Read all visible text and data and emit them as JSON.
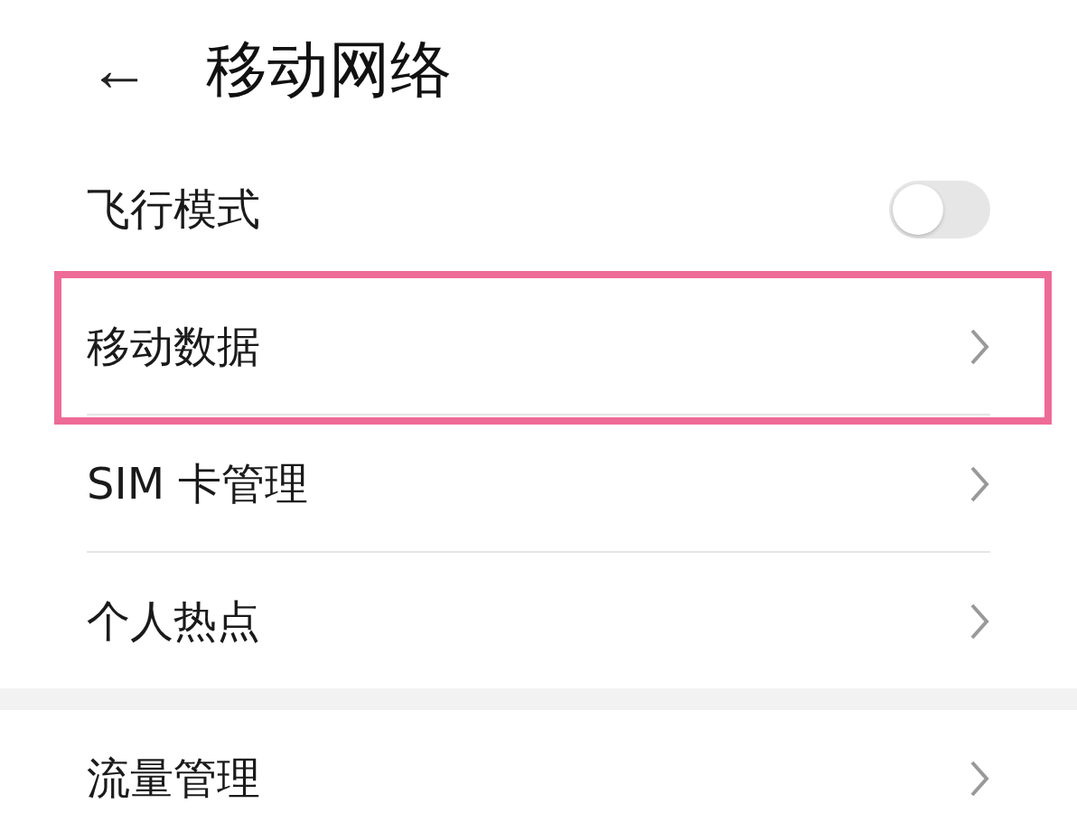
{
  "header": {
    "back": "←",
    "title": "移动网络"
  },
  "sections": [
    {
      "items": [
        {
          "kind": "toggle",
          "label": "飞行模式",
          "on": false,
          "highlighted": false
        },
        {
          "kind": "link",
          "label": "移动数据",
          "highlighted": true
        },
        {
          "kind": "link",
          "label": "SIM 卡管理",
          "highlighted": false
        },
        {
          "kind": "link",
          "label": "个人热点",
          "highlighted": false
        }
      ]
    },
    {
      "items": [
        {
          "kind": "link",
          "label": "流量管理",
          "highlighted": false
        }
      ]
    }
  ]
}
